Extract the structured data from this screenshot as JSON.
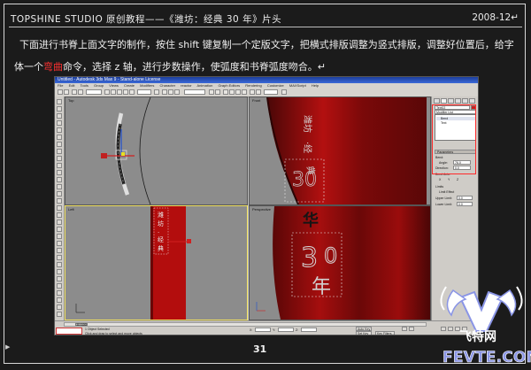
{
  "header": {
    "title_left": "TOPSHINE STUDIO 原创教程——《潍坊：经典 30 年》片头",
    "date": "2008-12",
    "date_mark": "↵"
  },
  "instruction": {
    "part1": "下面进行书脊上面文字的制作，按住 shift 键复制一个定版文字，把横式排版调整为竖式排版，调整好位置后，给字体一个",
    "highlight": "弯曲",
    "part2": "命令，选择 z 轴，进行步数操作，使弧度和书脊弧度吻合。↵"
  },
  "max_window": {
    "title": "Untitled - Autodesk 3ds Max 9 - Stand-alone License",
    "menus": [
      "File",
      "Edit",
      "Tools",
      "Group",
      "Views",
      "Create",
      "Modifiers",
      "Character",
      "reactor",
      "Animation",
      "Graph Editors",
      "Rendering",
      "Customize",
      "MAXScript",
      "Help"
    ],
    "viewports": [
      {
        "label": "Top"
      },
      {
        "label": "Front"
      },
      {
        "label": "Left"
      },
      {
        "label": "Perspective"
      }
    ],
    "command_panel": {
      "object_name": "Text02",
      "modifier_list_label": "Modifier List",
      "modifiers": [
        "Bend",
        "Text"
      ],
      "rollout_params": "Parameters",
      "bend_label": "Bend:",
      "angle_label": "Angle:",
      "angle_value": "76.0",
      "direction_label": "Direction:",
      "direction_value": "0.0",
      "bend_axis_label": "Bend Axis:",
      "axis_x": "X",
      "axis_y": "Y",
      "axis_z": "Z",
      "limits_label": "Limits",
      "limit_effect": "Limit Effect",
      "upper_label": "Upper Limit:",
      "upper_value": "0.0",
      "lower_label": "Lower Limit:",
      "lower_value": "0.0"
    },
    "status": {
      "frame_counter": "0 / 100",
      "selected": "1 Object Selected",
      "hint": "Click and drag to select and move objects",
      "x_label": "X:",
      "y_label": "Y:",
      "z_label": "Z:",
      "auto_key": "Auto Key",
      "set_key": "Set Key",
      "key_filters": "Key Filters..."
    },
    "book_spine_text": "潍坊·经典"
  },
  "page_number": "31",
  "watermark": {
    "logo_name": "飞特网",
    "url": "FEVTE.COM"
  },
  "colors": {
    "background": "#1b1b1b",
    "text": "#f0f0f0",
    "highlight": "#ff3030",
    "red_box": "#ff2a2a",
    "viewport_grey": "#8c8c8c",
    "book_red": "#9a0b0b"
  }
}
